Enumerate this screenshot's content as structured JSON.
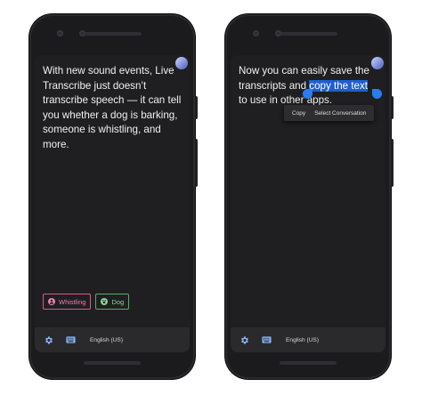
{
  "left_phone": {
    "transcript": "With new sound events, Live Transcribe just doesn’t transcribe speech — it can tell you whether a dog is barking, someone is whistling, and more.",
    "chips": [
      {
        "label": "Whistling",
        "icon": "person-icon",
        "color": "#e782ad"
      },
      {
        "label": "Dog",
        "icon": "paw-icon",
        "color": "#8fd197"
      }
    ],
    "language": "English (US)"
  },
  "right_phone": {
    "transcript_before": "Now you can easily save the transcripts and ",
    "transcript_selected": "copy the text",
    "transcript_after": " to use in other apps.",
    "context_menu": [
      "Copy",
      "Select Conversation"
    ],
    "language": "English (US)"
  },
  "colors": {
    "selection": "#1f5fd0",
    "handle": "#2b7bf2",
    "whistle_chip": "#d45c8f",
    "dog_chip": "#5fa86a"
  }
}
